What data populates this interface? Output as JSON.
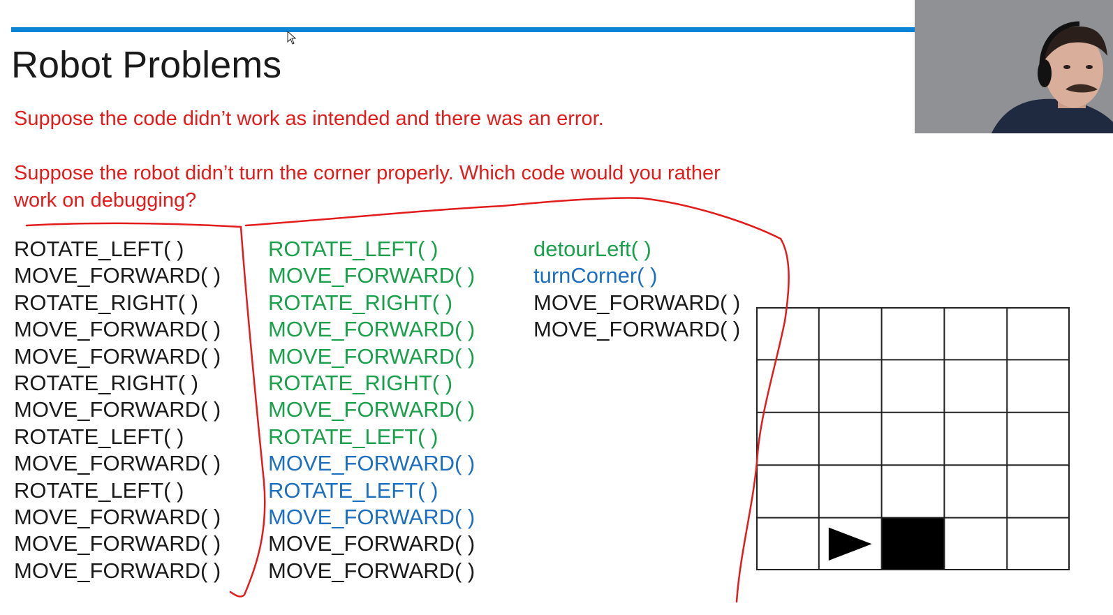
{
  "slide": {
    "title": "Robot Problems",
    "prompt_1": "Suppose the code didn’t work as intended and there was an error.",
    "prompt_2": "Suppose the robot didn’t turn the corner properly.  Which code would you rather work on debugging?"
  },
  "code_columns": [
    {
      "lines": [
        {
          "text": "ROTATE_LEFT( )",
          "color": "black"
        },
        {
          "text": "MOVE_FORWARD( )",
          "color": "black"
        },
        {
          "text": "ROTATE_RIGHT( )",
          "color": "black"
        },
        {
          "text": "MOVE_FORWARD( )",
          "color": "black"
        },
        {
          "text": "MOVE_FORWARD( )",
          "color": "black"
        },
        {
          "text": "ROTATE_RIGHT( )",
          "color": "black"
        },
        {
          "text": "MOVE_FORWARD( )",
          "color": "black"
        },
        {
          "text": "ROTATE_LEFT( )",
          "color": "black"
        },
        {
          "text": "MOVE_FORWARD( )",
          "color": "black"
        },
        {
          "text": "ROTATE_LEFT( )",
          "color": "black"
        },
        {
          "text": "MOVE_FORWARD( )",
          "color": "black"
        },
        {
          "text": "MOVE_FORWARD( )",
          "color": "black"
        },
        {
          "text": "MOVE_FORWARD( )",
          "color": "black"
        }
      ]
    },
    {
      "lines": [
        {
          "text": "ROTATE_LEFT( )",
          "color": "green"
        },
        {
          "text": "MOVE_FORWARD( )",
          "color": "green"
        },
        {
          "text": "ROTATE_RIGHT( )",
          "color": "green"
        },
        {
          "text": "MOVE_FORWARD( )",
          "color": "green"
        },
        {
          "text": "MOVE_FORWARD( )",
          "color": "green"
        },
        {
          "text": "ROTATE_RIGHT( )",
          "color": "green"
        },
        {
          "text": "MOVE_FORWARD( )",
          "color": "green"
        },
        {
          "text": "ROTATE_LEFT( )",
          "color": "green"
        },
        {
          "text": "MOVE_FORWARD( )",
          "color": "blue"
        },
        {
          "text": "ROTATE_LEFT( )",
          "color": "blue"
        },
        {
          "text": "MOVE_FORWARD( )",
          "color": "blue"
        },
        {
          "text": "MOVE_FORWARD( )",
          "color": "black"
        },
        {
          "text": "MOVE_FORWARD( )",
          "color": "black"
        }
      ]
    },
    {
      "lines": [
        {
          "text": "detourLeft( )",
          "color": "green"
        },
        {
          "text": "turnCorner( )",
          "color": "blue"
        },
        {
          "text": "MOVE_FORWARD( )",
          "color": "black"
        },
        {
          "text": "MOVE_FORWARD( )",
          "color": "black"
        }
      ]
    }
  ],
  "grid": {
    "rows": 5,
    "cols": 5,
    "robot": {
      "row": 5,
      "col": 2,
      "facing": "right"
    },
    "blocked": [
      {
        "row": 5,
        "col": 3
      }
    ]
  },
  "colors": {
    "accent_bar": "#0a84d6",
    "prompt_text": "#e21b1b",
    "annotation_ink": "#e21b1b",
    "code_black": "#1a1a1a",
    "code_green": "#18a04a",
    "code_blue": "#1c6fc0"
  },
  "icons": {
    "cursor": "mouse-pointer-icon",
    "robot": "robot-triangle-icon"
  }
}
